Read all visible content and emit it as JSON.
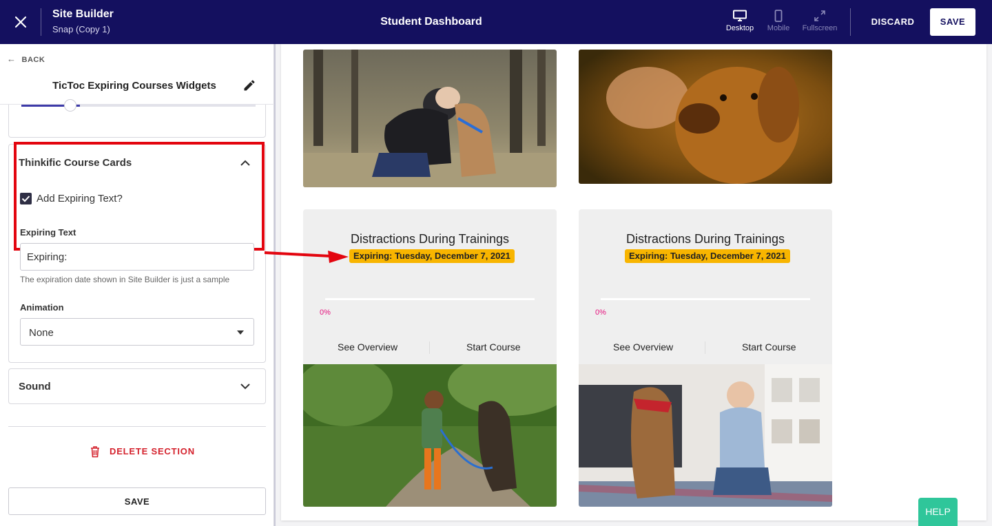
{
  "topbar": {
    "app_title": "Site Builder",
    "app_subtitle": "Snap (Copy 1)",
    "page_name": "Student Dashboard",
    "views": {
      "desktop": "Desktop",
      "mobile": "Mobile",
      "fullscreen": "Fullscreen"
    },
    "discard_label": "DISCARD",
    "save_label": "SAVE"
  },
  "sidebar": {
    "back_label": "BACK",
    "panel_title": "TicToc Expiring Courses Widgets",
    "slider_fraction": 0.25,
    "section_title": "Thinkific Course Cards",
    "checkbox_label": "Add Expiring Text?",
    "checkbox_checked": true,
    "expiring_text_label": "Expiring Text",
    "expiring_text_value": "Expiring:",
    "help_text": "The expiration date shown in Site Builder is just a sample",
    "animation_label": "Animation",
    "animation_value": "None",
    "sound_label": "Sound",
    "delete_label": "DELETE SECTION",
    "save_label": "SAVE"
  },
  "preview": {
    "cards": [
      {
        "title": "Distractions During Trainings",
        "expiry": "Expiring: Tuesday, December 7, 2021",
        "progress_pct": 0,
        "progress_text": "0%",
        "overview_label": "See Overview",
        "start_label": "Start Course"
      },
      {
        "title": "Distractions During Trainings",
        "expiry": "Expiring: Tuesday, December 7, 2021",
        "progress_pct": 0,
        "progress_text": "0%",
        "overview_label": "See Overview",
        "start_label": "Start Course"
      }
    ]
  },
  "help_label": "HELP",
  "colors": {
    "topbar": "#14105f",
    "highlight": "#e3050f",
    "badge": "#f8b500",
    "progress": "#e5127d",
    "help": "#2fc69a"
  }
}
